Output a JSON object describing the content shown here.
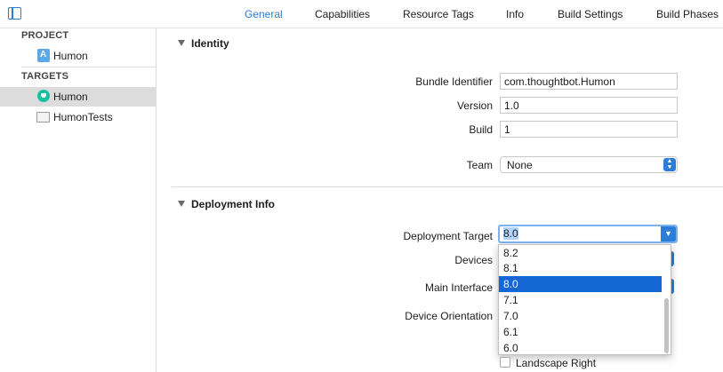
{
  "tabs": [
    "General",
    "Capabilities",
    "Resource Tags",
    "Info",
    "Build Settings",
    "Build Phases"
  ],
  "active_tab": "General",
  "sidebar": {
    "project_header": "PROJECT",
    "project_items": [
      {
        "label": "Humon",
        "icon": "app-project-icon"
      }
    ],
    "targets_header": "TARGETS",
    "target_items": [
      {
        "label": "Humon",
        "icon": "app-target-icon",
        "selected": true
      },
      {
        "label": "HumonTests",
        "icon": "folder-icon",
        "selected": false
      }
    ]
  },
  "identity": {
    "title": "Identity",
    "bundle_identifier_label": "Bundle Identifier",
    "bundle_identifier_value": "com.thoughtbot.Humon",
    "version_label": "Version",
    "version_value": "1.0",
    "build_label": "Build",
    "build_value": "1",
    "team_label": "Team",
    "team_value": "None"
  },
  "deployment": {
    "title": "Deployment Info",
    "target_label": "Deployment Target",
    "target_value": "8.0",
    "devices_label": "Devices",
    "main_interface_label": "Main Interface",
    "orientation_label": "Device Orientation",
    "landscape_right_label": "Landscape Right",
    "dropdown_options": [
      "8.2",
      "8.1",
      "8.0",
      "7.1",
      "7.0",
      "6.1",
      "6.0"
    ],
    "dropdown_highlighted": "8.0"
  },
  "colors": {
    "accent": "#2a7ed6",
    "highlight": "#1466d5",
    "selection_row": "#dcdcdc"
  }
}
